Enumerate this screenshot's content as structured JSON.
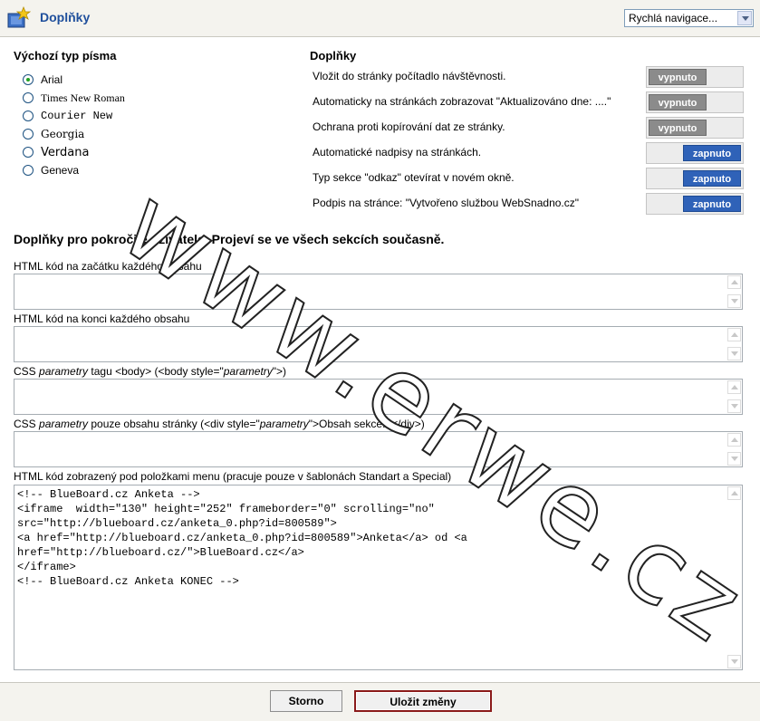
{
  "header": {
    "title": "Doplňky",
    "quick_nav": "Rychlá navigace..."
  },
  "fonts": {
    "title": "Výchozí typ písma",
    "options": [
      {
        "label": "Arial",
        "checked": true
      },
      {
        "label": "Times New Roman",
        "checked": false
      },
      {
        "label": "Courier New",
        "checked": false
      },
      {
        "label": "Georgia",
        "checked": false
      },
      {
        "label": "Verdana",
        "checked": false
      },
      {
        "label": "Geneva",
        "checked": false
      }
    ]
  },
  "addons": {
    "title": "Doplňky",
    "items": [
      {
        "label": "Vložit do stránky počítadlo návštěvnosti.",
        "state": "vypnuto"
      },
      {
        "label": "Automaticky na stránkách zobrazovat  \"Aktualizováno dne: ....\"",
        "state": "vypnuto"
      },
      {
        "label": "Ochrana proti kopírování dat ze stránky.",
        "state": "vypnuto"
      },
      {
        "label": "Automatické nadpisy na stránkách.",
        "state": "zapnuto"
      },
      {
        "label": "Typ sekce \"odkaz\" otevírat v novém okně.",
        "state": "zapnuto"
      },
      {
        "label": "Podpis na stránce: \"Vytvořeno službou WebSnadno.cz\"",
        "state": "zapnuto"
      }
    ]
  },
  "advanced": {
    "title": "Doplňky pro pokročilé uživatele. Projeví se ve všech sekcích současně.",
    "label_html_start": "HTML kód na začátku každého obsahu",
    "label_html_end": "HTML kód na konci každého obsahu",
    "label_css_body_1": "CSS ",
    "label_css_body_em1": "parametry",
    "label_css_body_2": " tagu <body> (<body style=\"",
    "label_css_body_em2": "parametry",
    "label_css_body_3": "\">)",
    "label_css_content_1": "CSS ",
    "label_css_content_em1": "parametry",
    "label_css_content_2": " pouze obsahu stránky (<div style=\"",
    "label_css_content_em2": "parametry",
    "label_css_content_3": "\">Obsah sekce...</div>)",
    "label_menu_code": "HTML kód zobrazený pod položkami menu (pracuje pouze v šablonách Standart a Special)",
    "menu_code": "<!-- BlueBoard.cz Anketa -->\n<iframe  width=\"130\" height=\"252\" frameborder=\"0\" scrolling=\"no\"\nsrc=\"http://blueboard.cz/anketa_0.php?id=800589\">\n<a href=\"http://blueboard.cz/anketa_0.php?id=800589\">Anketa</a> od <a\nhref=\"http://blueboard.cz/\">BlueBoard.cz</a>\n</iframe>\n<!-- BlueBoard.cz Anketa KONEC -->"
  },
  "footer": {
    "cancel": "Storno",
    "save": "Uložit změny"
  },
  "watermark": "www.erwe.cz",
  "colors": {
    "accent": "#1f4f9c",
    "toggle_on": "#2f62b8",
    "toggle_off": "#8b8b8b",
    "save_border": "#8b1a1a"
  }
}
